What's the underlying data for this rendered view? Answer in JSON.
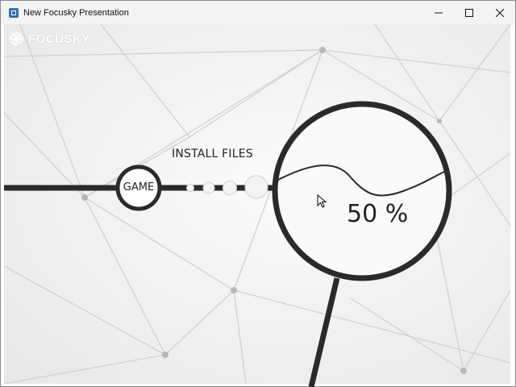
{
  "window": {
    "title": "New Focusky Presentation",
    "controls": [
      "minimize-icon",
      "maximize-icon",
      "close-icon"
    ]
  },
  "logo": {
    "text": "FOCUSKY"
  },
  "presentation": {
    "stage_label": "INSTALL FILES",
    "node_label": "GAME",
    "progress": {
      "value": 50,
      "text": "50 %"
    }
  },
  "colors": {
    "ink": "#2a2a2a",
    "background": "#f6f6f6",
    "network_lines": "#cfcfcf",
    "titlebar": "#f3f3f3"
  }
}
